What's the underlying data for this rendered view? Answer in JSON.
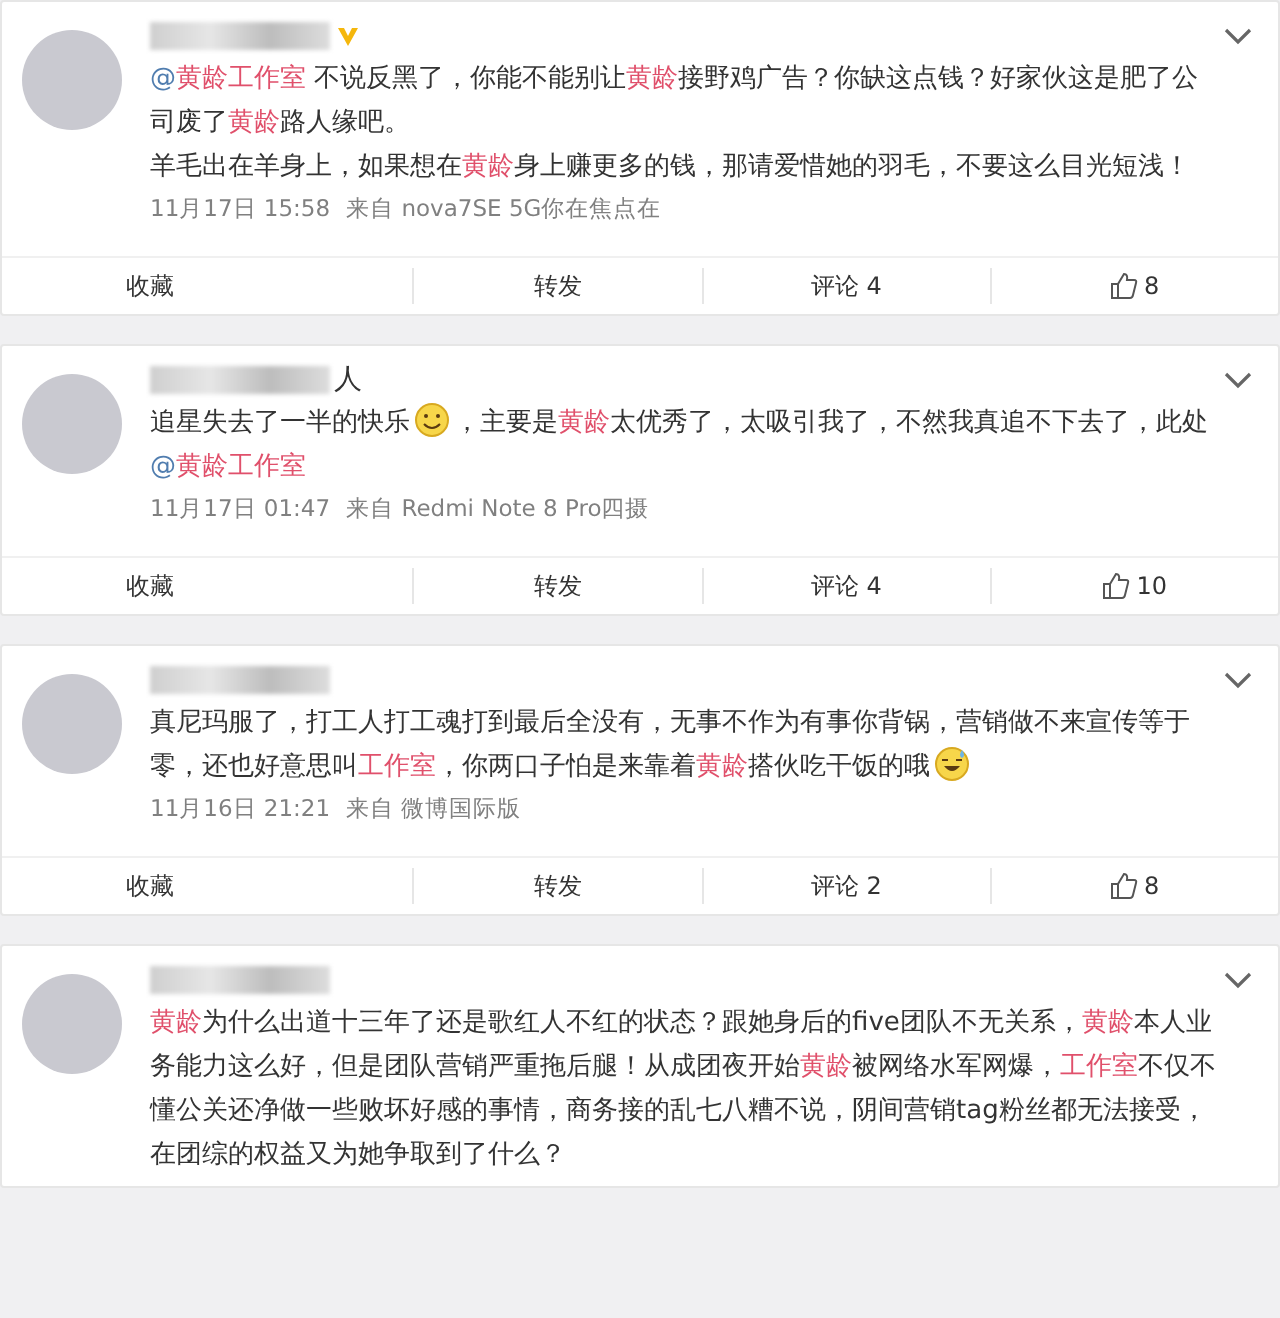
{
  "posts": [
    {
      "verified": true,
      "paragraphs": [
        [
          {
            "kind": "at",
            "text": "@"
          },
          {
            "kind": "mention",
            "text": "黄龄工作室"
          },
          {
            "kind": "plain",
            "text": " 不说反黑了，你能不能别让"
          },
          {
            "kind": "mention",
            "text": "黄龄"
          },
          {
            "kind": "plain",
            "text": "接野鸡广告？你缺这点钱？好家伙这是肥了公司废了"
          },
          {
            "kind": "mention",
            "text": "黄龄"
          },
          {
            "kind": "plain",
            "text": "路人缘吧。"
          }
        ],
        [
          {
            "kind": "plain",
            "text": "羊毛出在羊身上，如果想在"
          },
          {
            "kind": "mention",
            "text": "黄龄"
          },
          {
            "kind": "plain",
            "text": "身上赚更多的钱，那请爱惜她的羽毛，不要这么目光短浅！"
          }
        ]
      ],
      "time": "11月17日 15:58",
      "source": "来自 nova7SE 5G你在焦点在",
      "actions": {
        "favorite": "收藏",
        "repost": "转发",
        "comment": "评论 4",
        "likes": "8"
      }
    },
    {
      "name_tail": "人",
      "verified": false,
      "paragraphs": [
        [
          {
            "kind": "plain",
            "text": "追星失去了一半的快乐"
          },
          {
            "kind": "emoji"
          },
          {
            "kind": "plain",
            "text": "，主要是"
          },
          {
            "kind": "mention",
            "text": "黄龄"
          },
          {
            "kind": "plain",
            "text": "太优秀了，太吸引我了，不然我真追不下去了，此处 "
          },
          {
            "kind": "at",
            "text": "@"
          },
          {
            "kind": "mention",
            "text": "黄龄工作室"
          }
        ]
      ],
      "time": "11月17日 01:47",
      "source": "来自 Redmi Note 8 Pro四摄",
      "actions": {
        "favorite": "收藏",
        "repost": "转发",
        "comment": "评论 4",
        "likes": "10"
      }
    },
    {
      "verified": false,
      "paragraphs": [
        [
          {
            "kind": "plain",
            "text": "真尼玛服了，打工人打工魂打到最后全没有，无事不作为有事你背锅，营销做不来宣传等于零，还也好意思叫"
          },
          {
            "kind": "mention",
            "text": "工作室"
          },
          {
            "kind": "plain",
            "text": "，你两口子怕是来靠着"
          },
          {
            "kind": "mention",
            "text": "黄龄"
          },
          {
            "kind": "plain",
            "text": "搭伙吃干饭的哦"
          },
          {
            "kind": "sweat"
          }
        ]
      ],
      "time": "11月16日 21:21",
      "source": "来自 微博国际版",
      "actions": {
        "favorite": "收藏",
        "repost": "转发",
        "comment": "评论 2",
        "likes": "8"
      }
    },
    {
      "verified": false,
      "paragraphs": [
        [
          {
            "kind": "mention",
            "text": "黄龄"
          },
          {
            "kind": "plain",
            "text": "为什么出道十三年了还是歌红人不红的状态？跟她身后的five团队不无关系，"
          },
          {
            "kind": "mention",
            "text": "黄龄"
          },
          {
            "kind": "plain",
            "text": "本人业务能力这么好，但是团队营销严重拖后腿！从成团夜开始"
          },
          {
            "kind": "mention",
            "text": "黄龄"
          },
          {
            "kind": "plain",
            "text": "被网络水军网爆，"
          },
          {
            "kind": "mention",
            "text": "工作室"
          },
          {
            "kind": "plain",
            "text": "不仅不懂公关还净做一些败坏好感的事情，商务接的乱七八糟不说，阴间营销tag粉丝都无法接受，在团综的权益又为她争取到了什么？"
          }
        ]
      ]
    }
  ]
}
